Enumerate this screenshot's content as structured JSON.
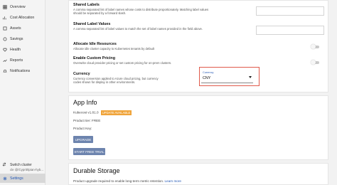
{
  "sidebar": {
    "items": [
      {
        "label": "Overview",
        "icon": "dashboard-icon"
      },
      {
        "label": "Cost Allocation",
        "icon": "allocation-icon"
      },
      {
        "label": "Assets",
        "icon": "assets-icon"
      },
      {
        "label": "Savings",
        "icon": "savings-icon"
      },
      {
        "label": "Health",
        "icon": "health-icon"
      },
      {
        "label": "Reports",
        "icon": "reports-icon"
      },
      {
        "label": "Notifications",
        "icon": "bell-icon"
      }
    ],
    "switch_label": "Switch cluster",
    "switch_sub": "cle @/Cyprit/tpian-hyb...",
    "settings_label": "Settings"
  },
  "settings": {
    "shared_labels": {
      "label": "Shared Labels",
      "desc": "A comma separated list of label names whose costs to distribute proportionately. Matching label values should be separated by a forward slash."
    },
    "shared_label_values": {
      "label": "Shared Label Values",
      "desc": "A comma separated list of label values to match the set of label names provided in the field above."
    },
    "allocate_idle": {
      "label": "Allocate Idle Resources",
      "desc": "Allocate idle cluster capacity to Kubernetes tenants by default"
    },
    "custom_pricing": {
      "label": "Enable Custom Pricing",
      "desc": "Overwrite cloud provider pricing or set custom pricing for on-prem clusters."
    },
    "currency": {
      "label": "Currency",
      "desc": "Currency conversion applied to Azure cloud pricing, but currency codes shown for display in other environments.",
      "select_label": "Currency",
      "value": "CNY"
    }
  },
  "appinfo": {
    "title": "App Info",
    "version": "Kubecost v1.81.0",
    "badge": "UPDATE AVAILABLE",
    "product_tier": "Product tier: FREE",
    "product_key": "Product Key:",
    "upgrade_label": "UPGRADE",
    "trial_label": "START FREE TRIAL"
  },
  "storage": {
    "title": "Durable Storage",
    "desc": "Product upgrade required to enable long-term metric retention.",
    "link": "Learn more"
  }
}
